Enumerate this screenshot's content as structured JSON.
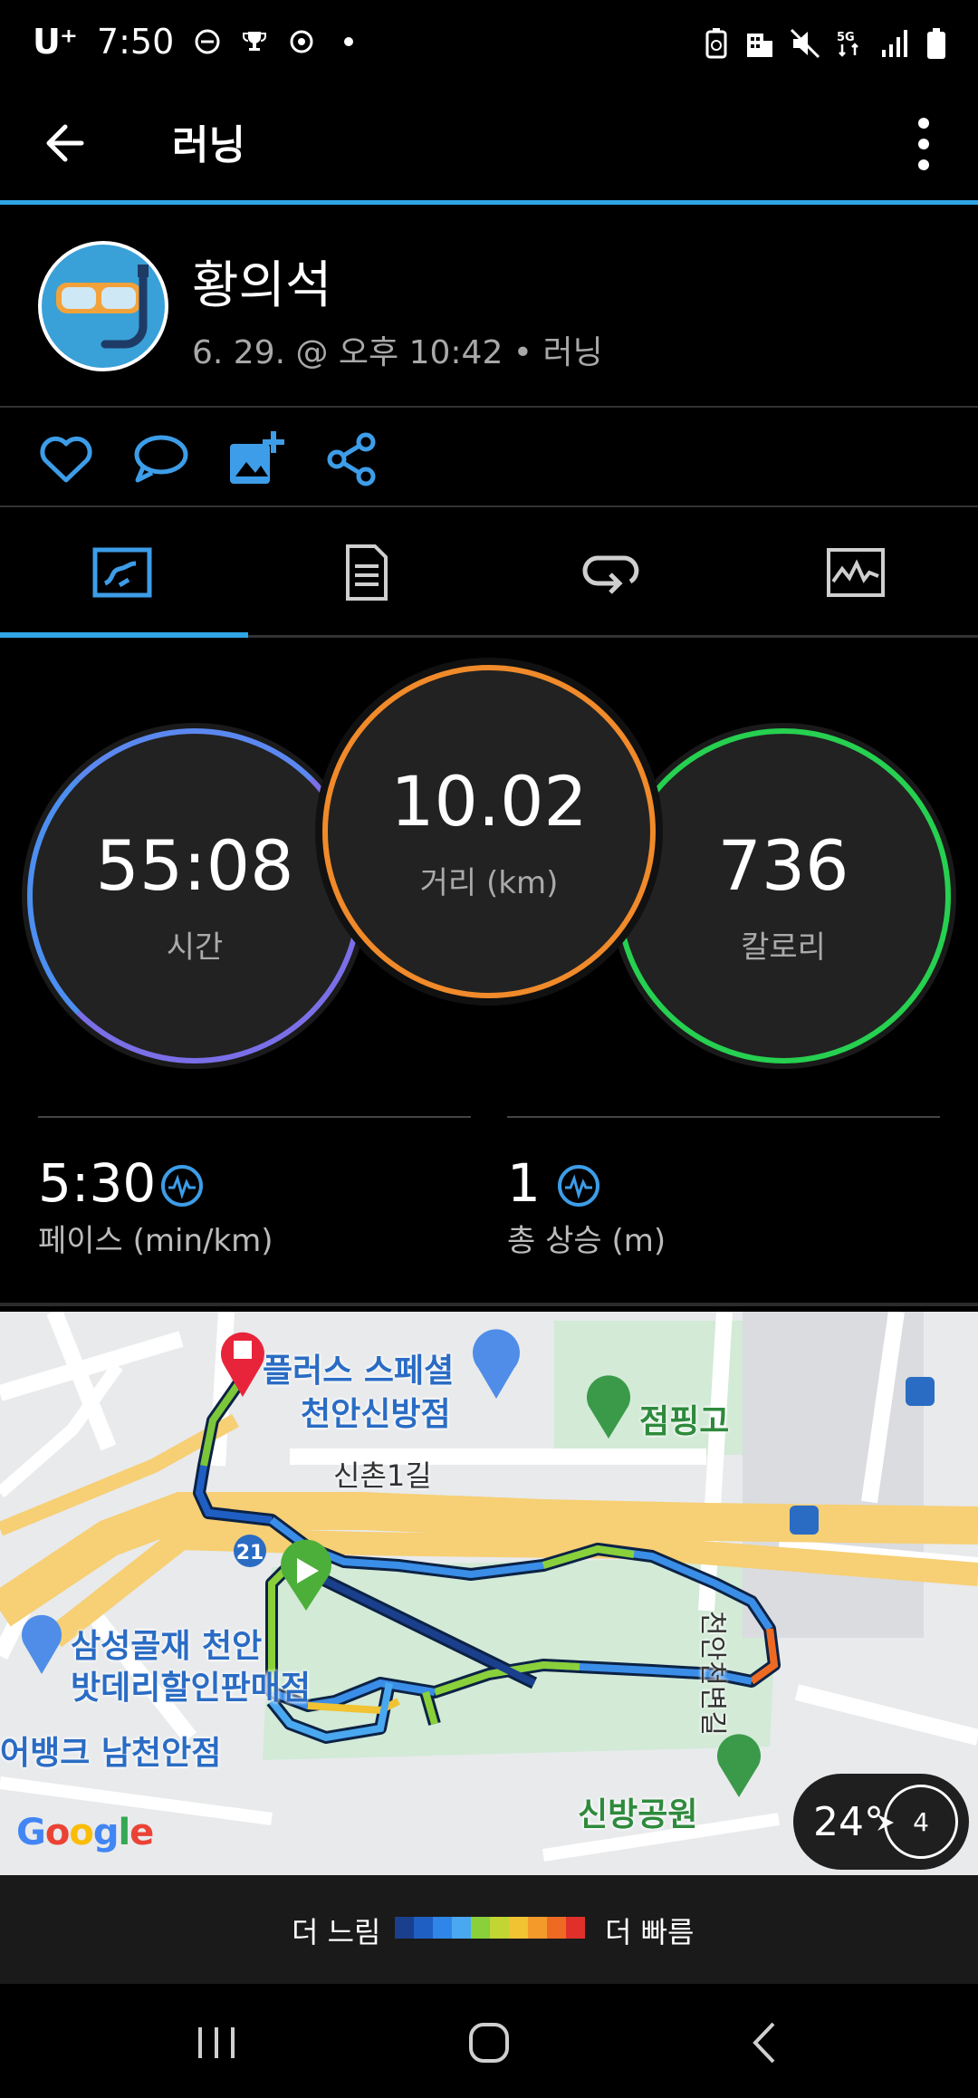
{
  "status_bar": {
    "carrier": "U⁺",
    "time": "7:50"
  },
  "app_bar": {
    "title": "러닝"
  },
  "profile": {
    "name": "황의석",
    "meta": "6. 29. @ 오후 10:42 • 러닝"
  },
  "tabs": [
    {
      "name": "overview",
      "icon": "map-overview-icon",
      "selected": true
    },
    {
      "name": "details",
      "icon": "document-icon",
      "selected": false
    },
    {
      "name": "laps",
      "icon": "laps-icon",
      "selected": false
    },
    {
      "name": "charts",
      "icon": "chart-icon",
      "selected": false
    }
  ],
  "stats": {
    "time": {
      "value": "55:08",
      "label": "시간"
    },
    "distance": {
      "value": "10.02",
      "label": "거리 (km)"
    },
    "calories": {
      "value": "736",
      "label": "칼로리"
    }
  },
  "substats": {
    "pace": {
      "value": "5:30",
      "label": "페이스 (min/km)"
    },
    "elevation": {
      "value": "1",
      "label": "총 상승 (m)"
    }
  },
  "map": {
    "labels": {
      "store1_line1": "플러스 스페셜",
      "store1_line2": "천안신방점",
      "school": "점핑고",
      "road1": "신촌1길",
      "store2_line1": "삼성골재 천안",
      "store2_line2": "밧데리할인판매점",
      "bank": "어뱅크 남천안점",
      "park": "신방공원",
      "road2": "천안천변길",
      "route_no": "21"
    },
    "google": "Google",
    "weather": {
      "temp": "24°",
      "wind": "4"
    }
  },
  "legend": {
    "slow": "더 느림",
    "fast": "더 빠름",
    "colors": [
      "#1a3f8c",
      "#1f5fc4",
      "#2f86e8",
      "#4aa8f0",
      "#8ad03a",
      "#c2d532",
      "#f1c232",
      "#f39a2b",
      "#ee6a22",
      "#e0302a"
    ]
  },
  "colors": {
    "accent": "#2fa5e6",
    "time_ring": "#7b6fe8",
    "distance_ring": "#f08a2a",
    "calories_ring": "#26d050"
  }
}
